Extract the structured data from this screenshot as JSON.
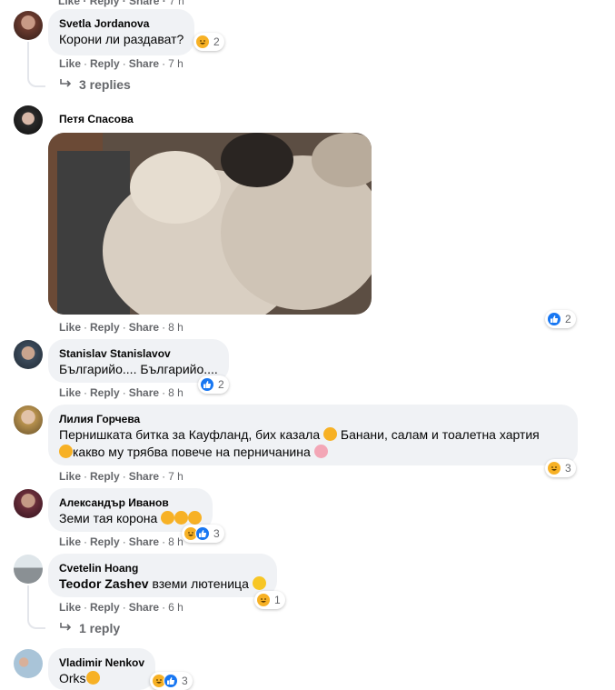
{
  "top": {
    "like": "Like",
    "reply": "Reply",
    "share": "Share",
    "time": "7 h"
  },
  "comments": [
    {
      "author": "Svetla Jordanova",
      "text": "Корони ли раздават?",
      "reactions": "2",
      "like": "Like",
      "reply": "Reply",
      "share": "Share",
      "time": "7 h",
      "replies": "3 replies"
    },
    {
      "author": "Петя Спасова",
      "reactions": "2",
      "like": "Like",
      "reply": "Reply",
      "share": "Share",
      "time": "8 h"
    },
    {
      "author": "Stanislav Stanislavov",
      "text": "Българийо.... Българийо....",
      "reactions": "2",
      "like": "Like",
      "reply": "Reply",
      "share": "Share",
      "time": "8 h"
    },
    {
      "author": "Лилия Горчева",
      "text_line1": "Пернишката битка за Кауфланд, бих казала",
      "text_line1b": "Банани, салам и тоалетна хартия",
      "text_line2": "какво му трябва повече на перничанина",
      "reactions": "3",
      "like": "Like",
      "reply": "Reply",
      "share": "Share",
      "time": "7 h"
    },
    {
      "author": "Александър Иванов",
      "text": "Земи тая корона",
      "reactions": "3",
      "like": "Like",
      "reply": "Reply",
      "share": "Share",
      "time": "8 h"
    },
    {
      "author": "Cvetelin Hoang",
      "mention": "Teodor Zashev",
      "text": "вземи лютеница",
      "reactions": "1",
      "like": "Like",
      "reply": "Reply",
      "share": "Share",
      "time": "6 h",
      "replies": "1 reply"
    },
    {
      "author": "Vladimir Nenkov",
      "text": "Orks",
      "reactions": "3"
    }
  ],
  "colors": {
    "bubble": "#f0f2f5",
    "meta": "#65676b",
    "like_blue": "#1877f2",
    "haha_yellow": "#f7b125"
  }
}
